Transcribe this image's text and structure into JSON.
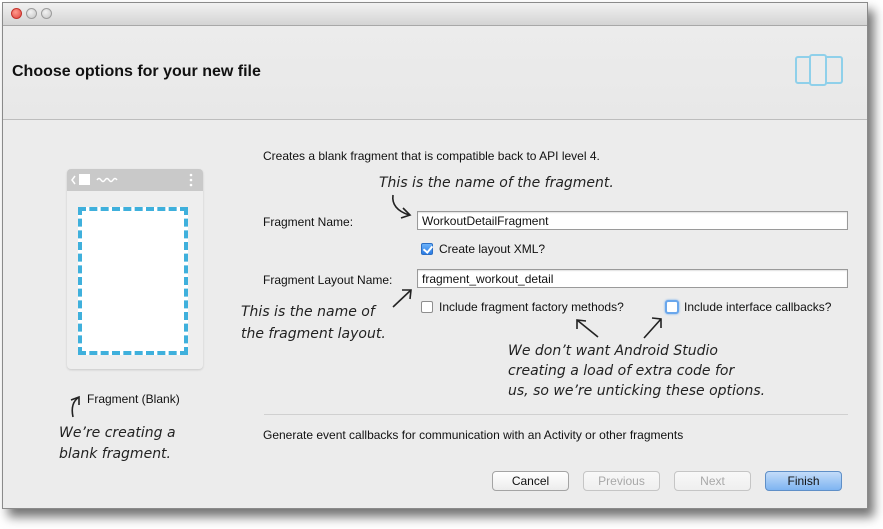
{
  "window": {
    "header_title": "Choose options for your new file"
  },
  "preview": {
    "caption": "Fragment (Blank)"
  },
  "form": {
    "description": "Creates a blank fragment that is compatible back to API level 4.",
    "fragment_name_label": "Fragment Name:",
    "fragment_name_value": "WorkoutDetailFragment",
    "create_layout_label": "Create layout XML?",
    "create_layout_checked": true,
    "layout_name_label": "Fragment Layout Name:",
    "layout_name_value": "fragment_workout_detail",
    "factory_methods_label": "Include fragment factory methods?",
    "factory_methods_checked": false,
    "interface_callbacks_label": "Include interface callbacks?",
    "interface_callbacks_checked": false,
    "event_callbacks_text": "Generate event callbacks for communication with an Activity or other fragments"
  },
  "buttons": {
    "cancel": "Cancel",
    "previous": "Previous",
    "next": "Next",
    "finish": "Finish"
  },
  "annotations": {
    "fragment_name_note": "This is the name of the fragment.",
    "layout_note_line1": "This is the name of",
    "layout_note_line2": "the fragment layout.",
    "options_note_line1": "We don’t want Android Studio",
    "options_note_line2": "creating a load of extra code for",
    "options_note_line3": "us, so we’re unticking these options.",
    "blank_note_line1": "We’re creating a",
    "blank_note_line2": "blank fragment."
  },
  "colors": {
    "accent_blue": "#3fb0dc",
    "finish_button": "#7eb4f1",
    "close_light": "#e0443e"
  },
  "icons": {
    "device": "device-preview-icon",
    "checkbox": "checkbox-icon"
  }
}
